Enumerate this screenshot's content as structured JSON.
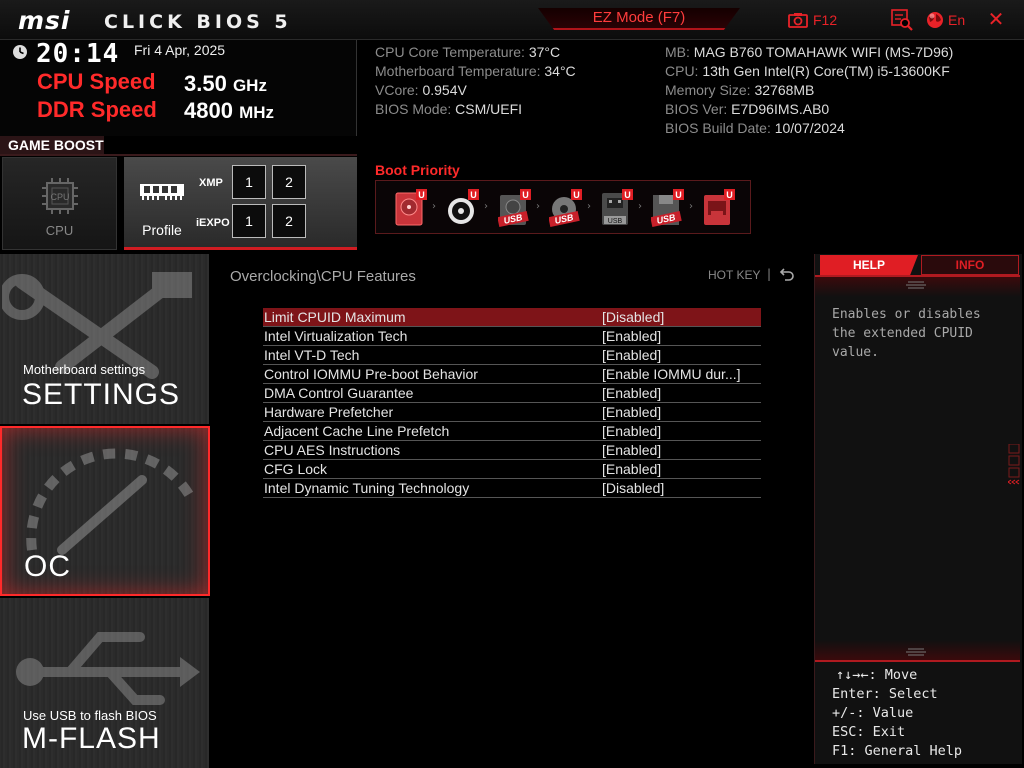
{
  "header": {
    "brand": "msi",
    "product": "CLICK BIOS 5",
    "ez_mode": "EZ Mode (F7)",
    "screenshot_key": "F12",
    "language": "En",
    "close": "✕"
  },
  "clock": {
    "time": "20:14",
    "date": "Fri  4 Apr, 2025"
  },
  "speeds": {
    "cpu_label": "CPU Speed",
    "cpu_value": "3.50",
    "cpu_unit": "GHz",
    "ddr_label": "DDR Speed",
    "ddr_value": "4800",
    "ddr_unit": "MHz"
  },
  "sysinfo": {
    "left": [
      {
        "label": "CPU Core Temperature: ",
        "value": "37°C"
      },
      {
        "label": "Motherboard Temperature: ",
        "value": "34°C"
      },
      {
        "label": "VCore: ",
        "value": "0.954V"
      },
      {
        "label": "BIOS Mode: ",
        "value": "CSM/UEFI"
      }
    ],
    "right": [
      {
        "label": "MB: ",
        "value": "MAG B760 TOMAHAWK WIFI (MS-7D96)"
      },
      {
        "label": "CPU: ",
        "value": "13th Gen Intel(R) Core(TM) i5-13600KF"
      },
      {
        "label": "Memory Size: ",
        "value": "32768MB"
      },
      {
        "label": "BIOS Ver: ",
        "value": "E7D96IMS.AB0"
      },
      {
        "label": "BIOS Build Date: ",
        "value": "10/07/2024"
      }
    ]
  },
  "game_boost": {
    "label": "GAME BOOST",
    "cpu_tile": "CPU",
    "profile_tile": "Profile",
    "xmp_label": "XMP",
    "iexpo_label": "iEXPO",
    "xmp_buttons": [
      "1",
      "2"
    ],
    "iexpo_buttons": [
      "1",
      "2"
    ]
  },
  "boot": {
    "title": "Boot Priority",
    "badge": "U",
    "usb_text": "USB",
    "devices": [
      "hdd",
      "optical",
      "usb-hdd",
      "usb-cd",
      "usb-key",
      "usb-floppy",
      "network"
    ]
  },
  "nav": {
    "settings_small": "Motherboard settings",
    "settings_big": "SETTINGS",
    "oc_big": "OC",
    "mflash_small": "Use USB to flash BIOS",
    "mflash_big": "M-FLASH"
  },
  "center": {
    "breadcrumb": "Overclocking\\CPU Features",
    "hotkey": "HOT KEY",
    "hotkey_sep": "|",
    "settings": [
      {
        "name": "Limit CPUID Maximum",
        "value": "[Disabled]",
        "selected": true
      },
      {
        "name": "Intel Virtualization Tech",
        "value": "[Enabled]"
      },
      {
        "name": "Intel VT-D Tech",
        "value": "[Enabled]"
      },
      {
        "name": "Control IOMMU Pre-boot Behavior",
        "value": "[Enable IOMMU dur...]"
      },
      {
        "name": "DMA Control Guarantee",
        "value": "[Enabled]"
      },
      {
        "name": "Hardware Prefetcher",
        "value": "[Enabled]"
      },
      {
        "name": "Adjacent Cache Line Prefetch",
        "value": "[Enabled]"
      },
      {
        "name": "CPU AES Instructions",
        "value": "[Enabled]"
      },
      {
        "name": "CFG Lock",
        "value": "[Enabled]"
      },
      {
        "name": "Intel Dynamic Tuning Technology",
        "value": "[Disabled]"
      }
    ]
  },
  "help": {
    "tab_help": "HELP",
    "tab_info": "INFO",
    "text_lines": [
      "Enables or disables",
      "the extended CPUID",
      "value."
    ],
    "keys": [
      "↑↓→←: Move",
      "Enter: Select",
      "+/-: Value",
      "ESC: Exit",
      "F1: General Help"
    ]
  },
  "colors": {
    "accent": "#e01e24",
    "selected_row": "#7e1418",
    "muted_text": "#8c8c8c"
  }
}
